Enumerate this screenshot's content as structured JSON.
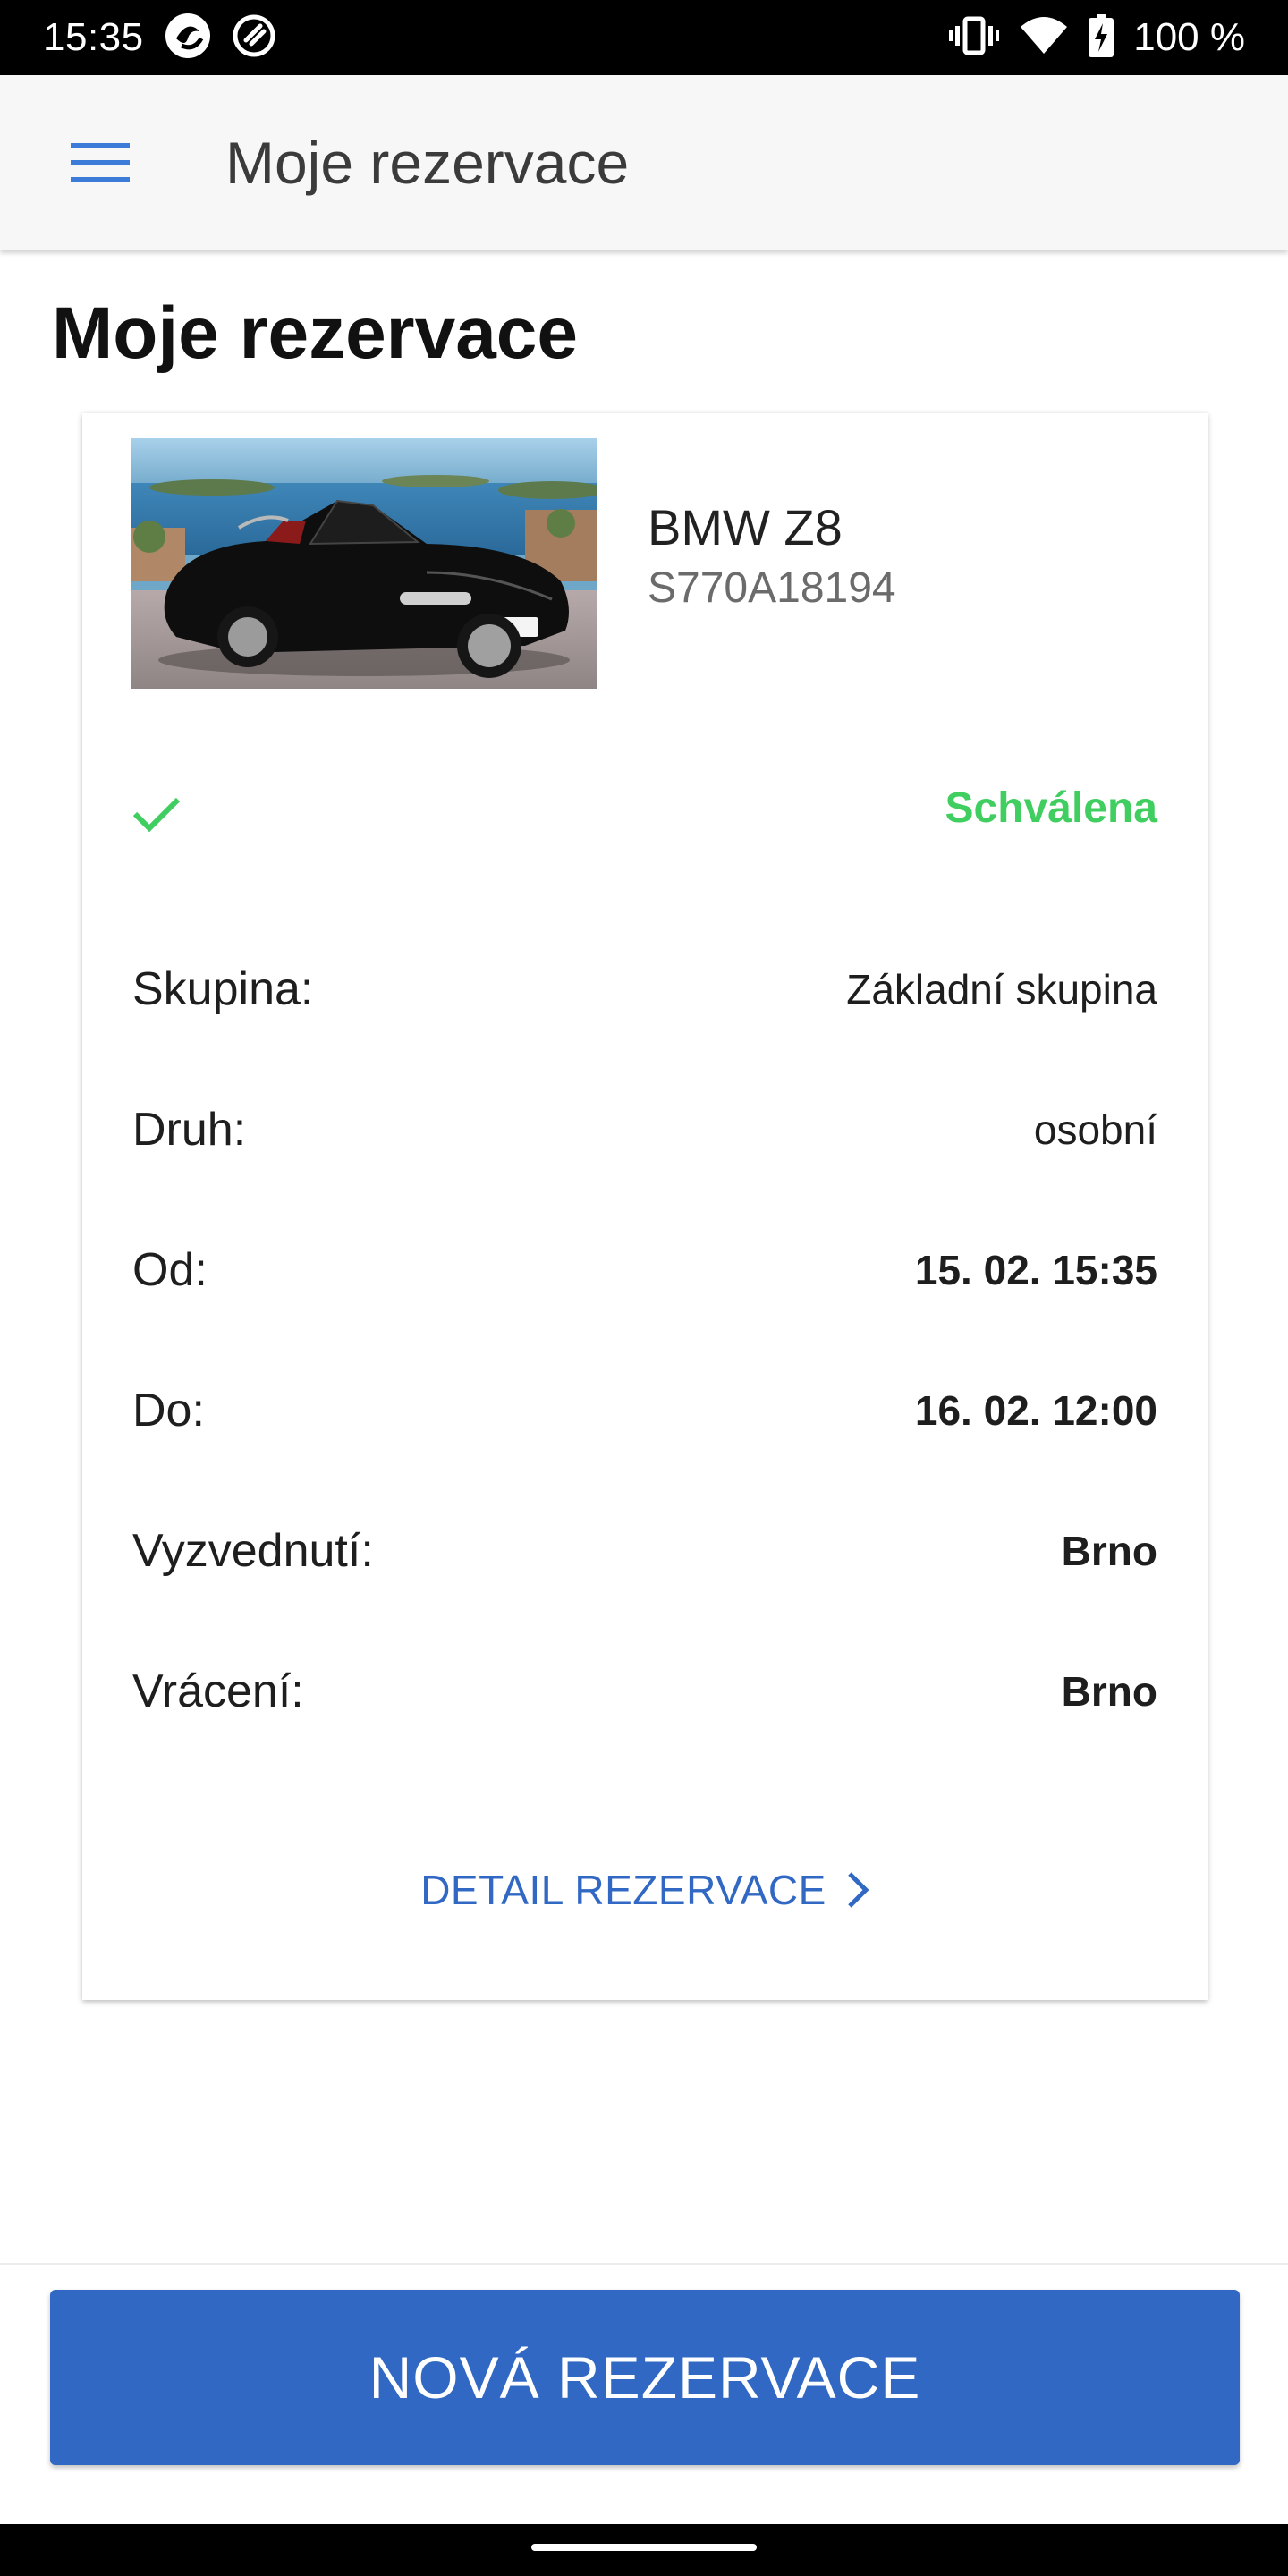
{
  "status_bar": {
    "time": "15:35",
    "battery_text": "100 %",
    "icons": [
      "app-icon",
      "at-icon",
      "vibrate-icon",
      "wifi-icon",
      "battery-charging-icon"
    ]
  },
  "app_bar": {
    "title": "Moje rezervace",
    "menu_icon": "hamburger-menu-icon"
  },
  "page": {
    "title": "Moje rezervace"
  },
  "reservation": {
    "car_name": "BMW Z8",
    "plate": "S770A18194",
    "car_image": "black-convertible-photo",
    "status_icon": "check-icon",
    "status": "Schválena",
    "status_color": "#3fce5f",
    "rows": [
      {
        "label": "Skupina:",
        "value": "Základní skupina",
        "bold": false
      },
      {
        "label": "Druh:",
        "value": "osobní",
        "bold": false
      },
      {
        "label": "Od:",
        "value": "15. 02. 15:35",
        "bold": true
      },
      {
        "label": "Do:",
        "value": "16. 02. 12:00",
        "bold": true
      },
      {
        "label": "Vyzvednutí:",
        "value": "Brno",
        "bold": true
      },
      {
        "label": "Vrácení:",
        "value": "Brno",
        "bold": true
      }
    ],
    "detail_link": "DETAIL REZERVACE"
  },
  "bottom": {
    "new_button": "NOVÁ REZERVACE",
    "accent": "#3168c4"
  }
}
